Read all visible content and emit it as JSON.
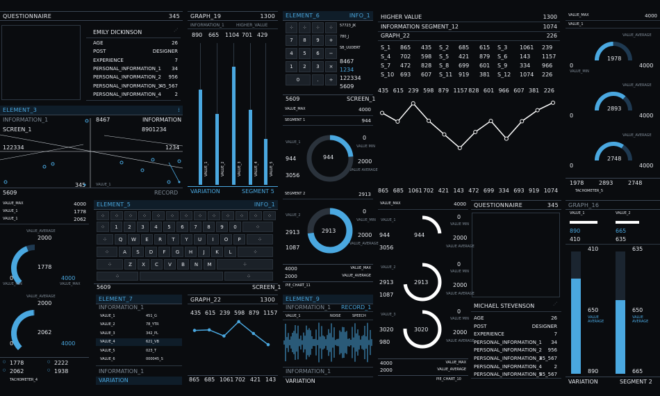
{
  "q1": {
    "title": "QUESTIONNAIRE",
    "count": "345",
    "name": "EMILY DICKINSON",
    "fields": [
      [
        "AGE",
        "26"
      ],
      [
        "POST",
        "DESIGNER"
      ],
      [
        "EXPERIENCE",
        "7"
      ],
      [
        "PERSONAL_INFORMATION_1",
        "34"
      ],
      [
        "PERSONAL_INFORMATION_2",
        "956"
      ],
      [
        "PERSONAL_INFORMATION_3",
        "45_567"
      ],
      [
        "PERSONAL_INFORMATION_4",
        "2"
      ]
    ]
  },
  "el3": {
    "title": "ELEMENT_3",
    "info": "INFORMATION_1",
    "val1": "8467",
    "info2": "INFORMATION",
    "screen": "SCREEN_1",
    "num": "8901234",
    "left": "122334",
    "right": "1234",
    "bottom": "345",
    "value1": "VALUE_1",
    "foot_num": "5609",
    "foot_label": "RECORD"
  },
  "g19": {
    "title": "GRAPH_19",
    "count": "1300",
    "sub1": "INFORMATION_1",
    "sub2": "HIGHER_VALUE",
    "vals": [
      "890",
      "665",
      "1104",
      "701",
      "429"
    ],
    "labels": [
      "VALUE_1",
      "VALUE_2",
      "VALUE_3",
      "VALUE_4",
      "VALUE_5"
    ],
    "foot1": "VARIATION",
    "foot2": "SEGMENT 5"
  },
  "el6": {
    "title": "ELEMENT_6",
    "info": "INFO_1",
    "codes": [
      "57723_JK",
      "780_J",
      "SB_UUDERT"
    ],
    "keys": [
      "7",
      "8",
      "9",
      "+",
      "4",
      "5",
      "6",
      "−",
      "1",
      "2",
      "3",
      "×",
      "0",
      ".",
      "÷"
    ],
    "lines": [
      "8467",
      "1234",
      "122334",
      "5609"
    ],
    "foot_num": "5609",
    "foot_label": "SCREEN_1"
  },
  "hv": {
    "r1": "HIGHER VALUE",
    "r1v": "1300",
    "r2": "INFORMATION SEGMENT_12",
    "r2v": "1074",
    "g": "GRAPH_22",
    "gv": "226",
    "table": [
      [
        "S_1",
        "865",
        "435",
        "S_2",
        "685",
        "615",
        "S_3",
        "1061",
        "239"
      ],
      [
        "S_4",
        "702",
        "598",
        "S_5",
        "421",
        "879",
        "S_6",
        "143",
        "1157"
      ],
      [
        "S_7",
        "472",
        "828",
        "S_8",
        "699",
        "601",
        "S_9",
        "334",
        "966"
      ],
      [
        "S_10",
        "693",
        "607",
        "S_11",
        "919",
        "381",
        "S_12",
        "1074",
        "226"
      ]
    ],
    "top": [
      "435",
      "615",
      "239",
      "598",
      "879",
      "1157",
      "828",
      "601",
      "966",
      "607",
      "381",
      "226"
    ],
    "bottom": [
      "865",
      "685",
      "1061",
      "702",
      "421",
      "143",
      "472",
      "699",
      "334",
      "693",
      "919",
      "1074"
    ]
  },
  "vm": {
    "title": "VALUE_MAX",
    "v1": "VALUE_1",
    "v1n": "4000",
    "gauges": [
      {
        "min": "0",
        "max": "4000",
        "v": "1978",
        "min_label": "VALUE_MIN",
        "avg_label": "VALUE_AVERAGE"
      },
      {
        "v": "2893"
      },
      {
        "v": "2748"
      }
    ],
    "bottom": [
      "1978",
      "2893",
      "2748"
    ],
    "foot": "TACHOMETER_5"
  },
  "tl": {
    "r1": "VALUE_MAX",
    "r1v": "4000",
    "r2": "VALUE_1",
    "r2v": "1778",
    "r3": "VALUE_1",
    "r3v": "2062",
    "g1": {
      "avg": "VALUE_AVERAGE",
      "top": "2000",
      "v": "1778",
      "max": "4000",
      "min": "0",
      "min_label": "VALUE_MIN",
      "max_label": "VALUE_MAX"
    },
    "g2": {
      "avg": "VALUE_AVERAGE",
      "top": "2000",
      "v": "2062",
      "max": "4000",
      "min": "0"
    },
    "cells": [
      "1778",
      "2222",
      "2062",
      "1938"
    ],
    "foot": "TACHOMETER_4"
  },
  "el5": {
    "title": "ELEMENT_5",
    "info": "INFO_1",
    "r1": [
      "1",
      "2",
      "3",
      "4",
      "5",
      "6",
      "7",
      "8",
      "9",
      "0"
    ],
    "r2": [
      "Q",
      "W",
      "E",
      "R",
      "T",
      "Y",
      "U",
      "I",
      "O",
      "P"
    ],
    "r3": [
      "A",
      "S",
      "D",
      "F",
      "G",
      "H",
      "J",
      "K",
      "L"
    ],
    "r4": [
      "Z",
      "X",
      "C",
      "V",
      "B",
      "N",
      "M"
    ],
    "foot_num": "5609",
    "foot_label": "SCREEN_1"
  },
  "pc": {
    "vmax": "VALUE_MAX",
    "vmaxv": "4000",
    "seg1": "SEGMENT 1",
    "seg1v": "944",
    "d1": {
      "v1": "VALUE_1",
      "n": "944",
      "c": "944",
      "t": "0",
      "min": "VALUE MIN",
      "avg": "2000",
      "b": "3056",
      "avg_l": "VALUE AVERAGE"
    },
    "seg2": "SEGMENT 2",
    "seg2v": "2913",
    "d2": {
      "v": "VALUE_2",
      "n": "2913",
      "c": "2913",
      "t": "0",
      "min": "VALUE_MIN",
      "avg": "2000",
      "b": "1087",
      "avg_l": "VALUE_AVERAGE"
    },
    "f1": "4000",
    "f1l": "VALUE_MAX",
    "f2": "2000",
    "f2l": "VALUE_AVERAGE",
    "foot": "PIE_CHART_11"
  },
  "pr": {
    "vmax": "VALUE_MAX",
    "vmaxv": "4000",
    "rings": [
      {
        "label": "VALUE_1",
        "a": "944",
        "b": "3056",
        "c": "944",
        "t": "0",
        "min": "VALUE MIN",
        "avg": "2000",
        "avg_l": "VALUE AVERAGE"
      },
      {
        "label": "VALUE_2",
        "a": "2913",
        "b": "1087",
        "c": "2913",
        "t": "0",
        "min": "VALUE MIN",
        "avg": "2000",
        "avg_l": "VALUE AVERAGE"
      },
      {
        "label": "VALUE_3",
        "a": "3020",
        "b": "980",
        "c": "3020",
        "t": "0",
        "min": "VALUE MIN",
        "avg": "2000",
        "avg_l": "VALUE AVERAGE"
      }
    ],
    "f1": "4000",
    "f1l": "VALUE_MAX",
    "f2": "2000",
    "f2l": "VALUE_AVERAGE",
    "foot": "PIE_CHART_10"
  },
  "q2": {
    "title": "QUESTIONNAIRE",
    "count": "345",
    "name": "MICHAEL STEVENSON",
    "fields": [
      [
        "AGE",
        "26"
      ],
      [
        "POST",
        "DESIGNER"
      ],
      [
        "EXPERIENCE",
        "7"
      ],
      [
        "PERSONAL_INFORMATION_1",
        "34"
      ],
      [
        "PERSONAL_INFORMATION_2",
        "956"
      ],
      [
        "PERSONAL_INFORMATION_3",
        "45_567"
      ],
      [
        "PERSONAL_INFORMATION_4",
        "2"
      ],
      [
        "PERSONAL_INFORMATION_5",
        "45_567"
      ]
    ]
  },
  "g16": {
    "title": "GRAPH_16",
    "v1": "VALUE_1",
    "v2": "VALUE_2",
    "a1": "890",
    "a2": "665",
    "b1": "410",
    "b2": "635",
    "t1": "410",
    "t2": "635",
    "m1": "650",
    "m2": "650",
    "avg": "VALUE AVERAGE",
    "e1": "890",
    "e2": "665",
    "foot1": "VARIATION",
    "foot2": "SEGMENT 2"
  },
  "el7": {
    "title": "ELEMENT_7",
    "info": "INFORMATION_1",
    "rows": [
      [
        "VALUE_1",
        "451_G"
      ],
      [
        "VALUE_2",
        "78_YTR"
      ],
      [
        "VALUE_3",
        "342_PL"
      ],
      [
        "VALUE_4",
        "621_VB"
      ],
      [
        "VALUE_5",
        "023_T"
      ],
      [
        "VALUE_6",
        "000045_S"
      ]
    ],
    "foot1": "INFORMATION_1",
    "foot2": "VARIATION"
  },
  "g22": {
    "title": "GRAPH_22",
    "count": "1300",
    "top": [
      "435",
      "615",
      "239",
      "598",
      "879",
      "1157"
    ],
    "bottom": [
      "865",
      "685",
      "1061",
      "702",
      "421",
      "143"
    ]
  },
  "el9": {
    "title": "ELEMENT_9",
    "info": "INFORMATION_1",
    "rec": "RECORD_1",
    "v1": "VALUE_1",
    "noise": "NOISE",
    "speech": "SPEECH",
    "foot1": "INFORMATION_1",
    "foot2": "VARIATION"
  }
}
